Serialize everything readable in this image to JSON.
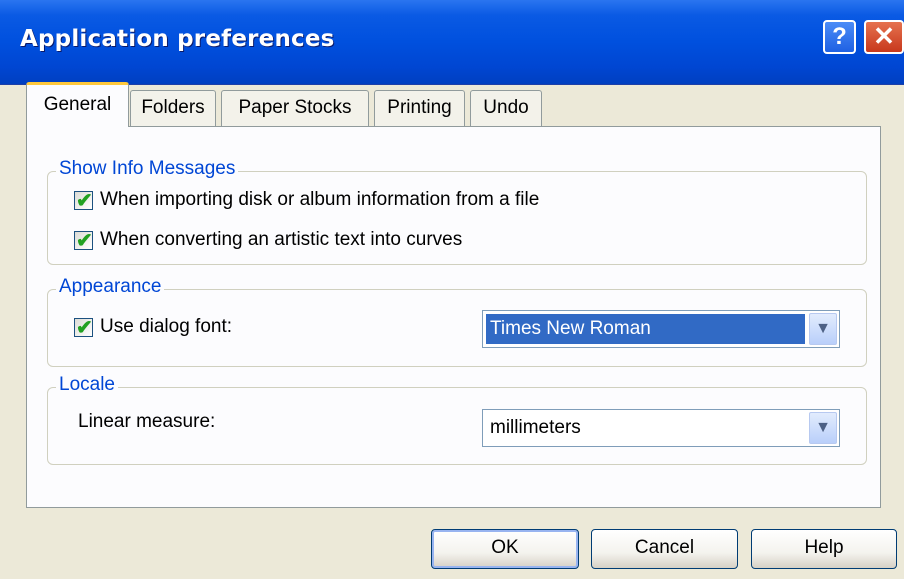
{
  "window": {
    "title": "Application preferences",
    "help_label": "?",
    "close_label": "✕"
  },
  "tabs": [
    {
      "label": "General",
      "active": true
    },
    {
      "label": "Folders",
      "active": false
    },
    {
      "label": "Paper Stocks",
      "active": false
    },
    {
      "label": "Printing",
      "active": false
    },
    {
      "label": "Undo",
      "active": false
    }
  ],
  "show_info": {
    "title": "Show Info Messages",
    "items": [
      {
        "label": "When importing disk or album information from a file",
        "checked": true
      },
      {
        "label": "When converting an artistic text into curves",
        "checked": true
      }
    ]
  },
  "appearance": {
    "title": "Appearance",
    "use_dialog_font": {
      "label": "Use dialog font:",
      "checked": true
    },
    "font_value": "Times New Roman"
  },
  "locale": {
    "title": "Locale",
    "linear_measure_label": "Linear measure:",
    "linear_measure_value": "millimeters"
  },
  "buttons": {
    "ok": "OK",
    "cancel": "Cancel",
    "help": "Help"
  },
  "glyphs": {
    "check": "✔",
    "dropdown": "▼"
  },
  "colors": {
    "titlebar": "#0050de",
    "group_title": "#0046d5",
    "selection": "#316ac5",
    "check": "#21a121"
  }
}
